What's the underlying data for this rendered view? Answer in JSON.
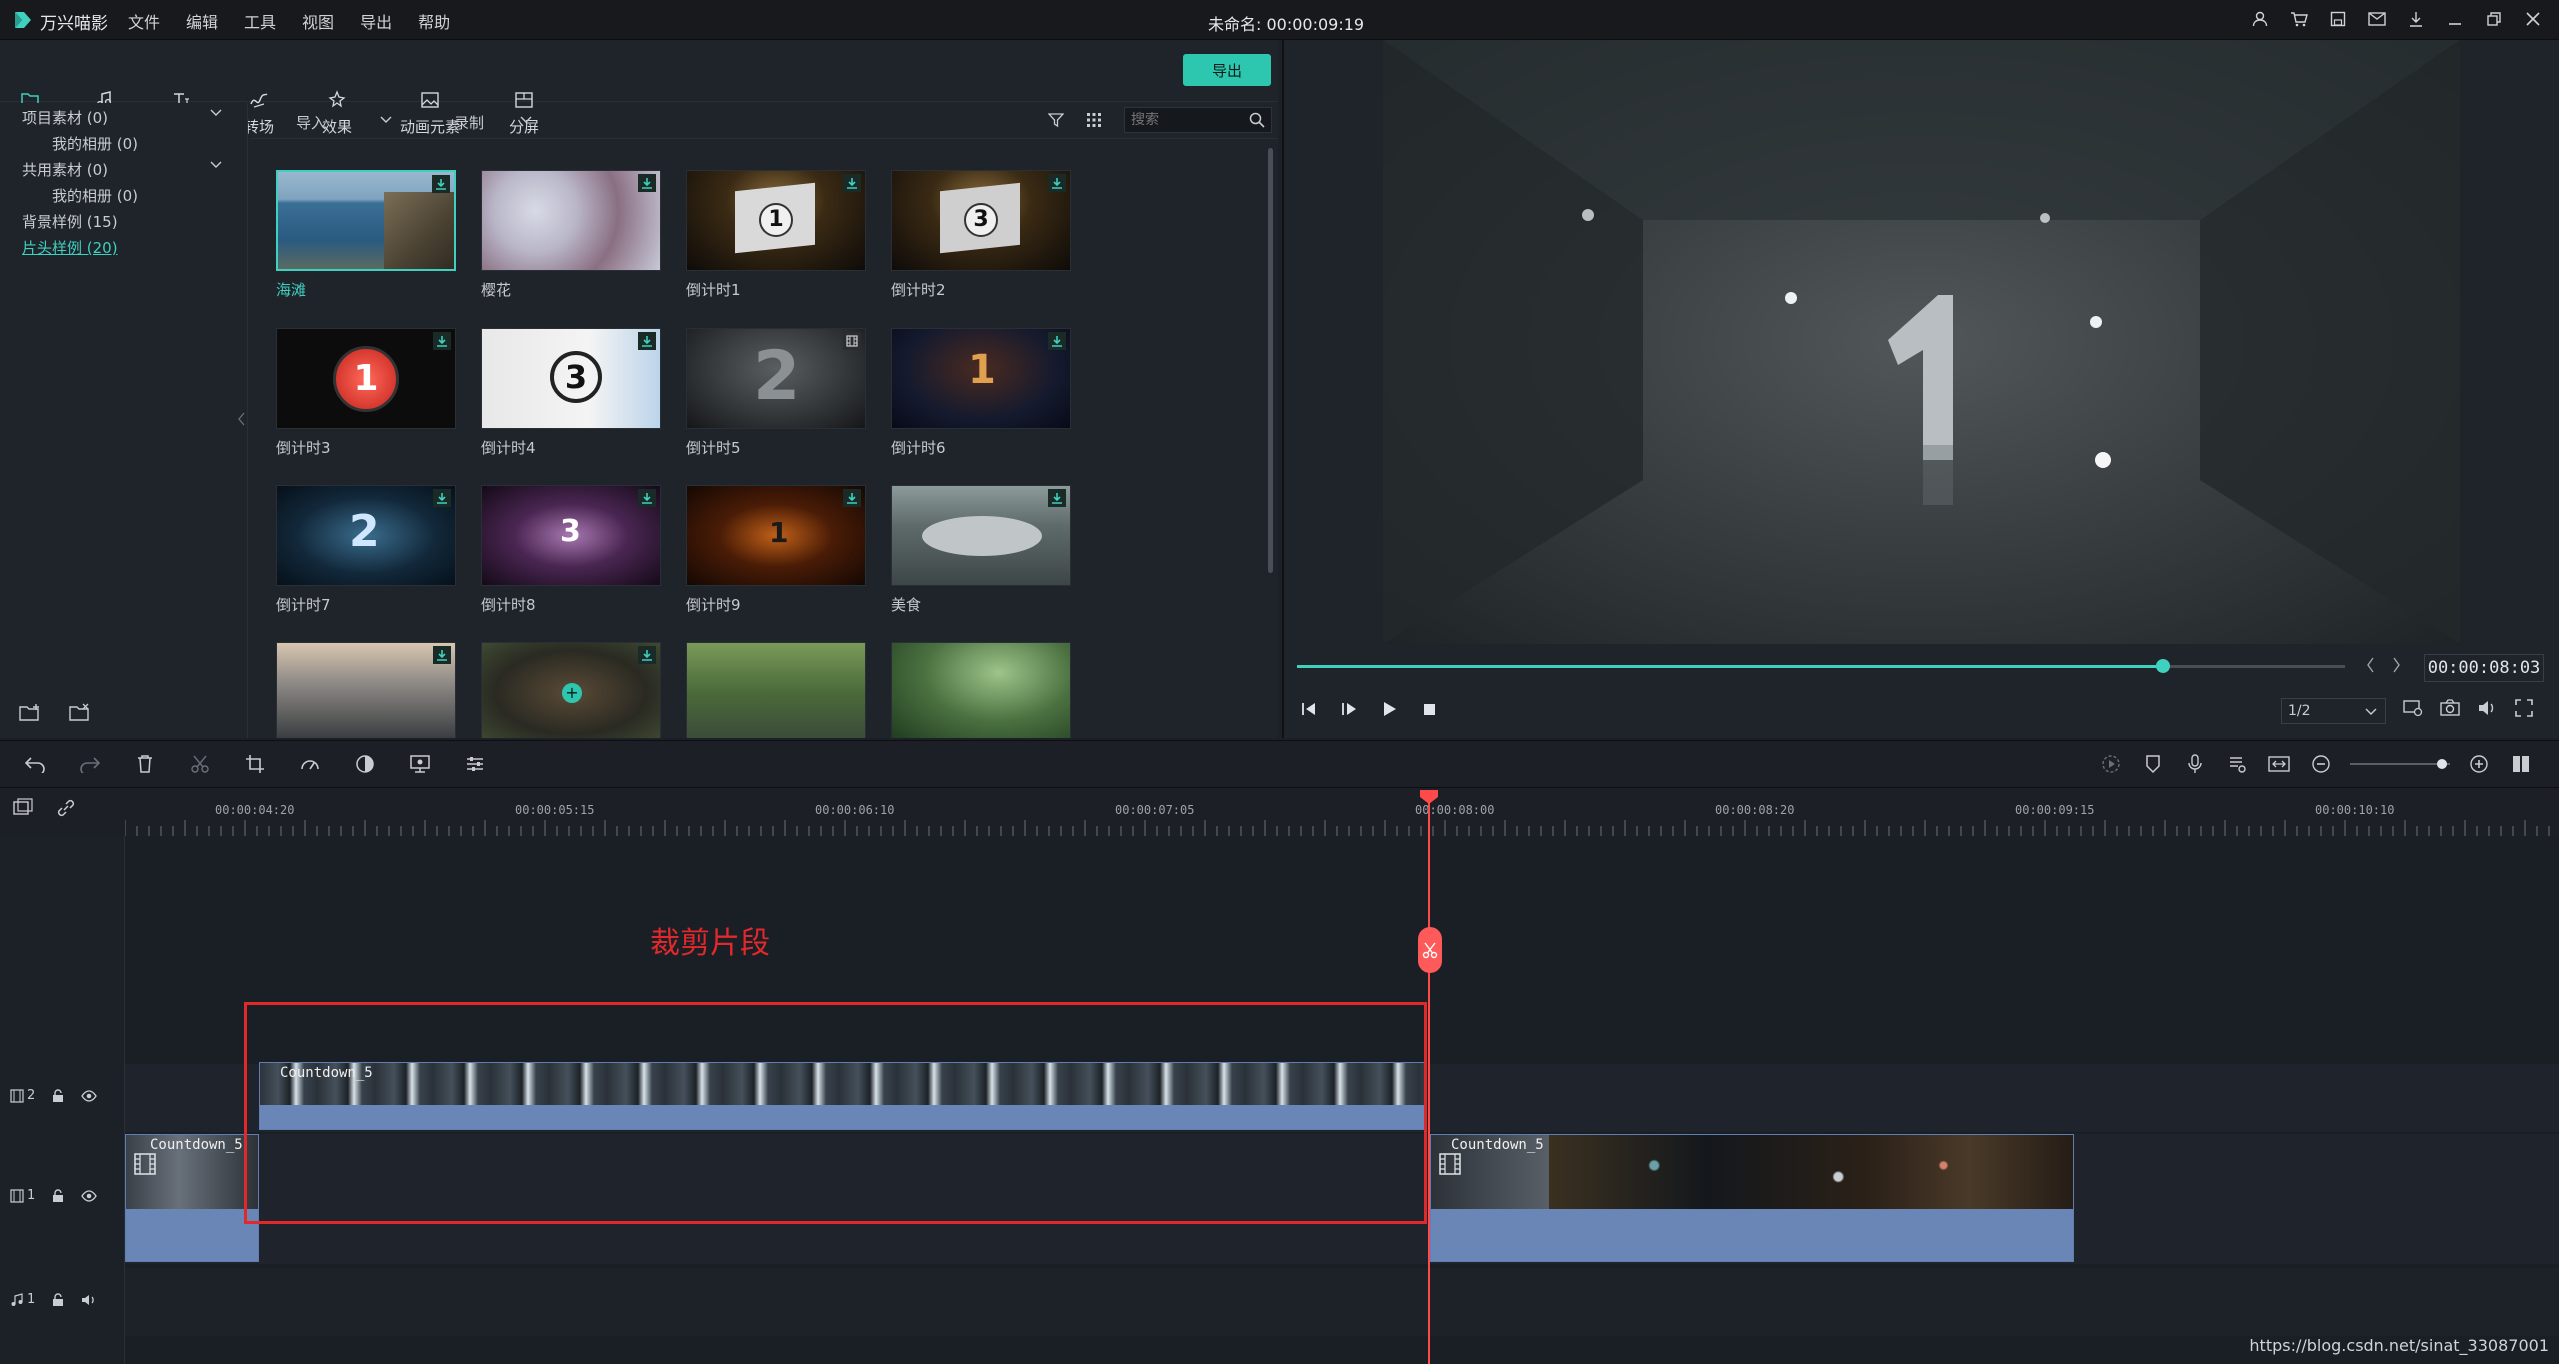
{
  "app": {
    "name": "万兴喵影",
    "project_title": "未命名: 00:00:09:19"
  },
  "menu": [
    "文件",
    "编辑",
    "工具",
    "视图",
    "导出",
    "帮助"
  ],
  "tabs": [
    {
      "label": "素材",
      "icon": "folder-icon",
      "active": true
    },
    {
      "label": "音频",
      "icon": "music-note-icon"
    },
    {
      "label": "文字",
      "icon": "text-icon"
    },
    {
      "label": "转场",
      "icon": "transition-icon"
    },
    {
      "label": "效果",
      "icon": "effects-icon"
    },
    {
      "label": "动画元素",
      "icon": "image-icon"
    },
    {
      "label": "分屏",
      "icon": "split-screen-icon"
    }
  ],
  "export_button": "导出",
  "library_tree": [
    {
      "label": "项目素材 (0)",
      "expandable": true
    },
    {
      "label": "我的相册 (0)"
    },
    {
      "label": "共用素材 (0)",
      "expandable": true
    },
    {
      "label": "我的相册 (0)"
    },
    {
      "label": "背景样例 (15)"
    },
    {
      "label": "片头样例 (20)",
      "selected": true
    }
  ],
  "media_toolbar": {
    "import_label": "导入",
    "record_label": "录制",
    "search_placeholder": "搜索"
  },
  "media_items": [
    {
      "label": "海滩",
      "selected": true
    },
    {
      "label": "樱花"
    },
    {
      "label": "倒计时1"
    },
    {
      "label": "倒计时2"
    },
    {
      "label": "倒计时3"
    },
    {
      "label": "倒计时4"
    },
    {
      "label": "倒计时5"
    },
    {
      "label": "倒计时6"
    },
    {
      "label": "倒计时7"
    },
    {
      "label": "倒计时8"
    },
    {
      "label": "倒计时9"
    },
    {
      "label": "美食"
    },
    {
      "label": ""
    },
    {
      "label": ""
    },
    {
      "label": ""
    },
    {
      "label": ""
    }
  ],
  "preview": {
    "timecode": "00:00:08:03",
    "progress": 0.826,
    "ratio": "1/2"
  },
  "ruler_labels": [
    "00:00:04:20",
    "00:00:05:15",
    "00:00:06:10",
    "00:00:07:05",
    "00:00:08:00",
    "00:00:08:20",
    "00:00:09:15",
    "00:00:10:10"
  ],
  "tracks": [
    {
      "label": "2",
      "kind": "video"
    },
    {
      "label": "1",
      "kind": "video"
    },
    {
      "label": "1",
      "kind": "audio"
    }
  ],
  "clips": {
    "name": "Countdown_5"
  },
  "annotation": "裁剪片段",
  "watermark": "https://blog.csdn.net/sinat_33087001",
  "colors": {
    "accent": "#3fd0bf",
    "playhead": "#ff4a4a",
    "annotation": "#e1292c"
  }
}
